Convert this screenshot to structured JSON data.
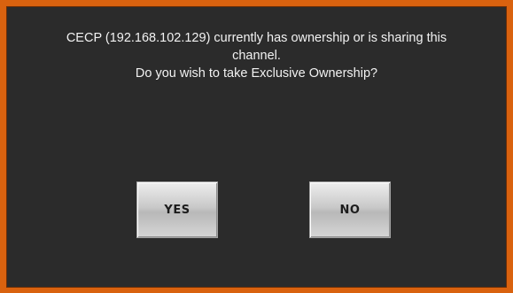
{
  "dialog": {
    "message_lines": [
      "CECP (192.168.102.129) currently has ownership or is sharing this",
      "channel.",
      "Do you wish to take Exclusive Ownership?"
    ],
    "buttons": {
      "yes_label": "YES",
      "no_label": "NO"
    },
    "colors": {
      "frame": "#d9620f",
      "background": "#2b2b2b",
      "text": "#f2f2f2",
      "button": "#cfcfcf"
    }
  }
}
